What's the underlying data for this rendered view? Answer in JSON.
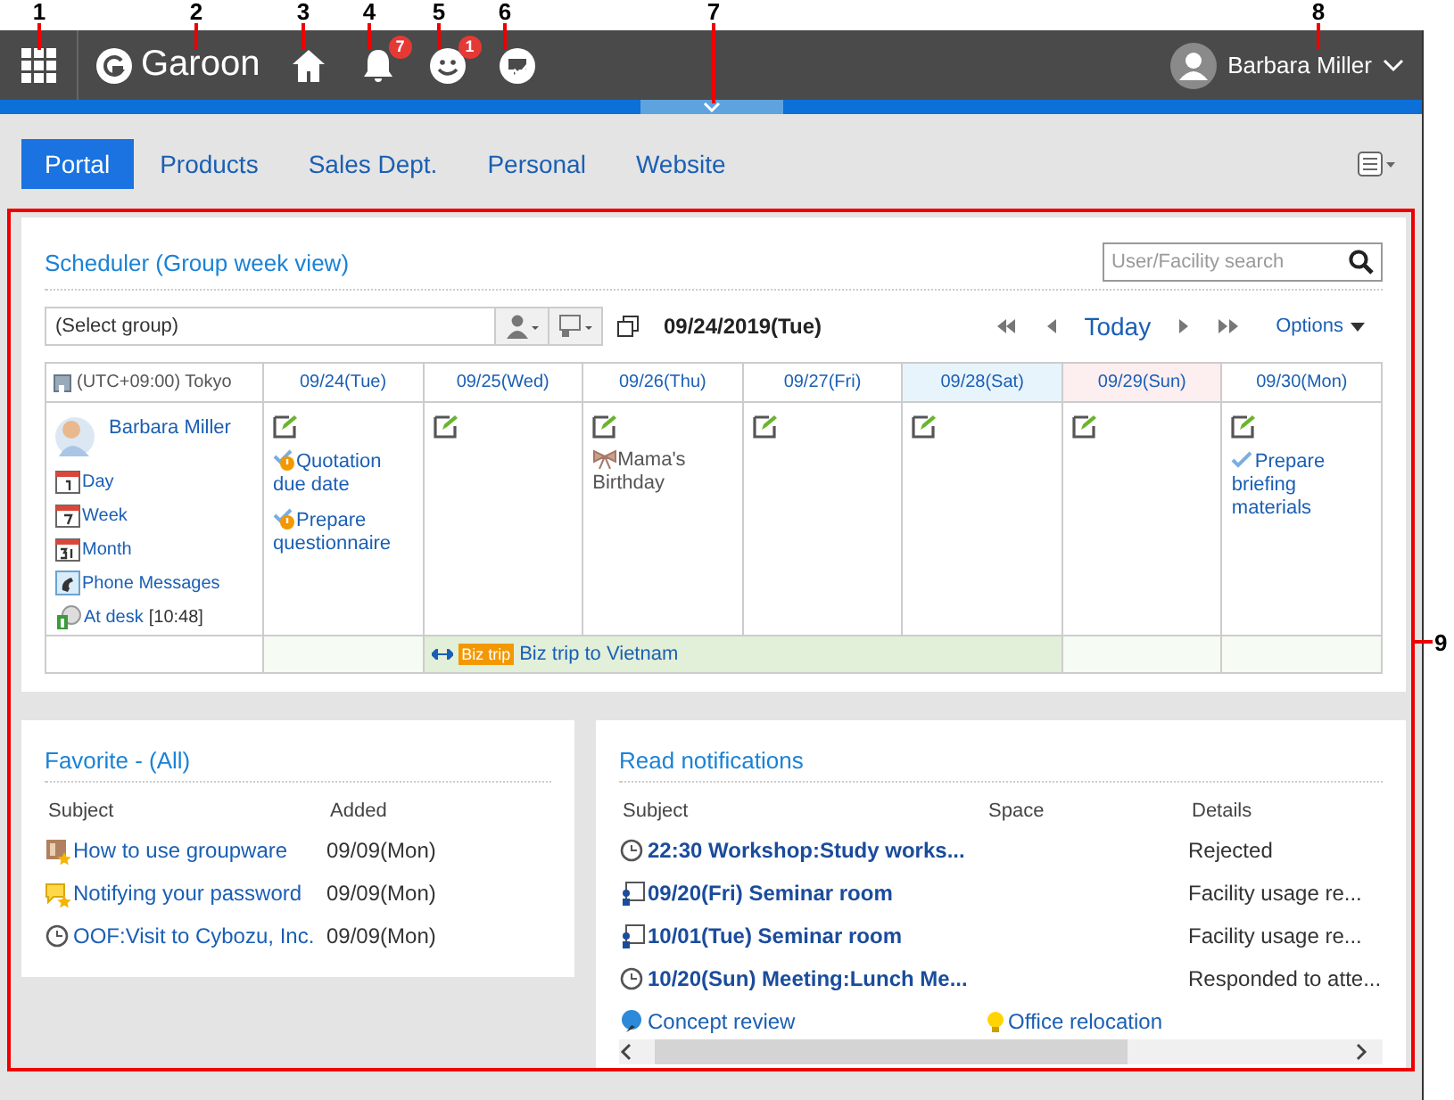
{
  "callouts": [
    {
      "label": "1"
    },
    {
      "label": "2"
    },
    {
      "label": "3"
    },
    {
      "label": "4"
    },
    {
      "label": "5"
    },
    {
      "label": "6"
    },
    {
      "label": "7"
    },
    {
      "label": "8"
    },
    {
      "label": "9"
    }
  ],
  "header": {
    "logo": "Garoon",
    "icons": [
      {
        "kind": "home"
      },
      {
        "kind": "bell",
        "badge": "7"
      },
      {
        "kind": "people",
        "badge": "1"
      },
      {
        "kind": "chat"
      }
    ],
    "user": "Barbara Miller"
  },
  "tabs": [
    {
      "label": "Portal",
      "selected": true
    },
    {
      "label": "Products",
      "selected": false
    },
    {
      "label": "Sales Dept.",
      "selected": false
    },
    {
      "label": "Personal",
      "selected": false
    },
    {
      "label": "Website",
      "selected": false
    }
  ],
  "scheduler": {
    "title": "Scheduler (Group week view)",
    "search": {
      "placeholder": "User/Facility search"
    },
    "group_select": "(Select group)",
    "date": "09/24/2019(Tue)",
    "today": "Today",
    "options": "Options",
    "timezone": "(UTC+09:00) Tokyo",
    "user": {
      "name": "Barbara Miller",
      "links": [
        {
          "kind": "day",
          "label": "Day"
        },
        {
          "kind": "week",
          "label": "Week"
        },
        {
          "kind": "month",
          "label": "Month"
        },
        {
          "kind": "phone",
          "label": "Phone Messages"
        },
        {
          "kind": "status",
          "label": "At desk",
          "note": "[10:48]"
        }
      ]
    },
    "days": [
      {
        "label": "09/24(Tue)",
        "kind": "weekday",
        "in_trip": false,
        "events": [
          {
            "kind": "todo_warning",
            "title": "Quotation due date"
          },
          {
            "kind": "todo_warning",
            "title": "Prepare questionnaire"
          }
        ]
      },
      {
        "label": "09/25(Wed)",
        "kind": "weekday",
        "in_trip": true
      },
      {
        "label": "09/26(Thu)",
        "kind": "weekday",
        "in_trip": true,
        "events": [
          {
            "kind": "birthday",
            "title": "Mama's Birthday"
          }
        ]
      },
      {
        "label": "09/27(Fri)",
        "kind": "weekday",
        "in_trip": true
      },
      {
        "label": "09/28(Sat)",
        "kind": "saturday",
        "in_trip": true
      },
      {
        "label": "09/29(Sun)",
        "kind": "sunday",
        "in_trip": false
      },
      {
        "label": "09/30(Mon)",
        "kind": "weekday",
        "in_trip": false,
        "events": [
          {
            "kind": "todo_done",
            "title": "Prepare briefing materials"
          }
        ]
      }
    ],
    "trip": {
      "tag": "Biz trip",
      "title": "Biz trip to Vietnam"
    }
  },
  "favorite": {
    "title": "Favorite - (All)",
    "columns": [
      "Subject",
      "Added"
    ],
    "rows": [
      {
        "kind": "document",
        "subject": "How to use groupware",
        "added": "09/09(Mon)"
      },
      {
        "kind": "message",
        "subject": "Notifying your password",
        "added": "09/09(Mon)"
      },
      {
        "kind": "schedule",
        "subject": "OOF:Visit to Cybozu, Inc.",
        "added": "09/09(Mon)"
      }
    ]
  },
  "notifications": {
    "title": "Read notifications",
    "columns": [
      "Subject",
      "Space",
      "Details"
    ],
    "rows": [
      {
        "kind": "schedule",
        "subject": "22:30 Workshop:Study works...",
        "details": "Rejected"
      },
      {
        "kind": "facility",
        "subject": "09/20(Fri) Seminar room",
        "details": "Facility usage re..."
      },
      {
        "kind": "facility",
        "subject": "10/01(Tue) Seminar room",
        "details": "Facility usage re..."
      },
      {
        "kind": "schedule",
        "subject": "10/20(Sun) Meeting:Lunch Me...",
        "details": "Responded to atte..."
      },
      {
        "kind": "space",
        "subject": "Concept review",
        "space": "Office relocation"
      }
    ]
  }
}
